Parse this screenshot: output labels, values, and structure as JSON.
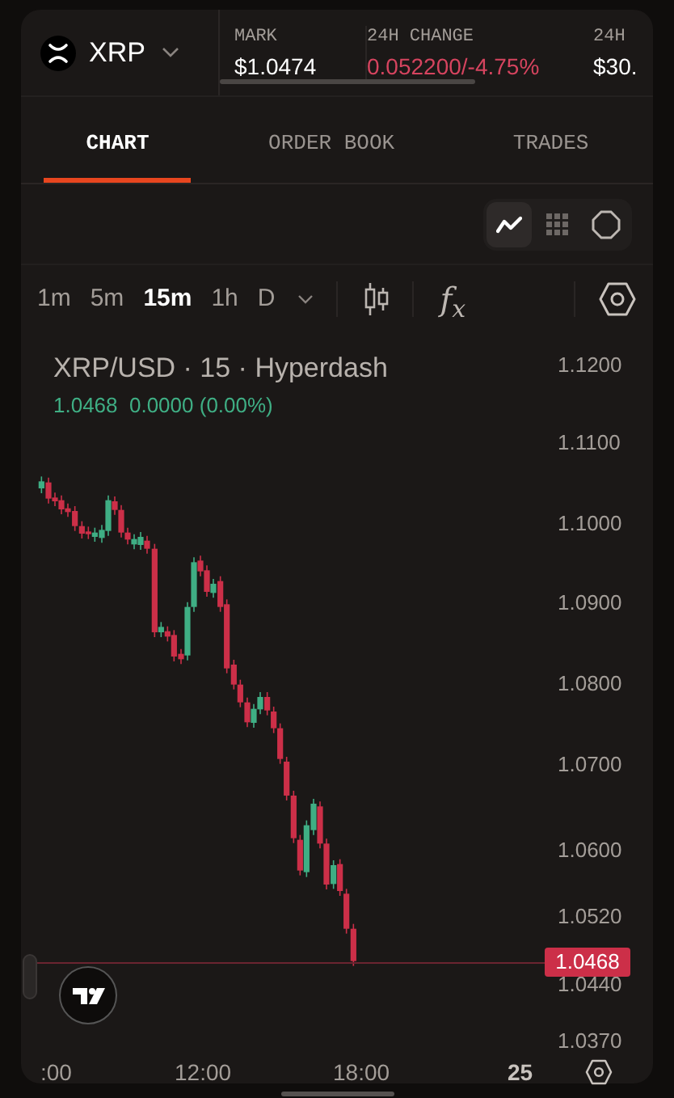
{
  "header": {
    "symbol": "XRP",
    "stats": [
      {
        "label": "MARK",
        "value": "$1.0474",
        "kind": "plain"
      },
      {
        "label": "24H CHANGE",
        "value": "0.052200/-4.75%",
        "kind": "negative"
      },
      {
        "label": "24H",
        "value": "$30.",
        "kind": "plain"
      }
    ]
  },
  "tabs": [
    {
      "label": "CHART",
      "selected": true
    },
    {
      "label": "ORDER BOOK",
      "selected": false
    },
    {
      "label": "TRADES",
      "selected": false
    }
  ],
  "chart_styles": [
    {
      "kind": "line",
      "selected": true
    },
    {
      "kind": "grid",
      "selected": false
    },
    {
      "kind": "octagon",
      "selected": false
    }
  ],
  "intervals": [
    {
      "label": "1m",
      "selected": false
    },
    {
      "label": "5m",
      "selected": false
    },
    {
      "label": "15m",
      "selected": true
    },
    {
      "label": "1h",
      "selected": false
    },
    {
      "label": "D",
      "selected": false
    }
  ],
  "indicators_label": "f$_{x}$",
  "legend": {
    "title": "XRP/USD · 15 · Hyperdash",
    "values": "1.0468  0.0000 (0.00%)"
  },
  "price_axis": [
    "1.1200",
    "1.1100",
    "1.1000",
    "1.0900",
    "1.0800",
    "1.0700",
    "1.0600",
    "1.0520",
    "1.0440",
    "1.0370"
  ],
  "last_price": "1.0468",
  "time_axis": [
    {
      "label": ":00",
      "bold": false
    },
    {
      "label": "12:00",
      "bold": false
    },
    {
      "label": "18:00",
      "bold": false
    },
    {
      "label": "25",
      "bold": true
    }
  ]
}
